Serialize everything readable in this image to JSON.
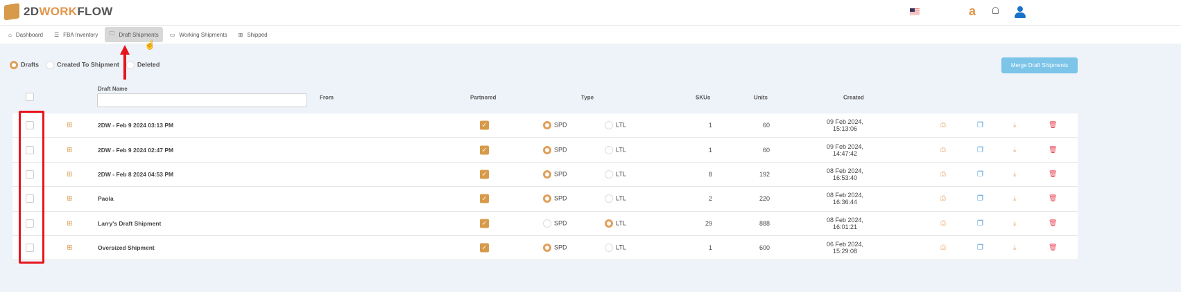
{
  "app": {
    "logo_prefix": "2D",
    "logo_accent": "WORK",
    "logo_suffix": "FLOW",
    "accent": "#e0964a"
  },
  "header_icons": [
    "us-flag-icon",
    "amazon-icon",
    "bell-icon",
    "user-icon"
  ],
  "nav": [
    {
      "label": "Dashboard",
      "icon": "home-icon"
    },
    {
      "label": "FBA Inventory",
      "icon": "list-icon"
    },
    {
      "label": "Draft Shipments",
      "icon": "folder-icon",
      "active": true
    },
    {
      "label": "Working Shipments",
      "icon": "monitor-icon"
    },
    {
      "label": "Shipped",
      "icon": "grid-icon"
    }
  ],
  "filters": [
    {
      "label": "Drafts",
      "selected": true
    },
    {
      "label": "Created To Shipment",
      "selected": false
    },
    {
      "label": "Deleted",
      "selected": false
    }
  ],
  "merge_label": "Merge Draft Shipments",
  "columns": {
    "name": "Draft Name",
    "from": "From",
    "partnered": "Partnered",
    "type": "Type",
    "skus": "SKUs",
    "units": "Units",
    "created": "Created"
  },
  "name_filter_placeholder": "",
  "type_options": [
    "SPD",
    "LTL"
  ],
  "rows": [
    {
      "name": "2DW - Feb 9 2024 03:13 PM",
      "partnered": true,
      "type": "SPD",
      "skus": "1",
      "units": "60",
      "created": "09 Feb 2024, 15:13:06"
    },
    {
      "name": "2DW - Feb 9 2024 02:47 PM",
      "partnered": true,
      "type": "SPD",
      "skus": "1",
      "units": "60",
      "created": "09 Feb 2024, 14:47:42"
    },
    {
      "name": "2DW - Feb 8 2024 04:53 PM",
      "partnered": true,
      "type": "SPD",
      "skus": "8",
      "units": "192",
      "created": "08 Feb 2024, 16:53:40"
    },
    {
      "name": "Paola",
      "partnered": true,
      "type": "SPD",
      "skus": "2",
      "units": "220",
      "created": "08 Feb 2024, 16:36:44"
    },
    {
      "name": "Larry's Draft Shipment",
      "partnered": true,
      "type": "LTL",
      "skus": "29",
      "units": "888",
      "created": "08 Feb 2024, 16:01:21"
    },
    {
      "name": "Oversized Shipment",
      "partnered": true,
      "type": "SPD",
      "skus": "1",
      "units": "600",
      "created": "06 Feb 2024, 15:29:08"
    }
  ]
}
